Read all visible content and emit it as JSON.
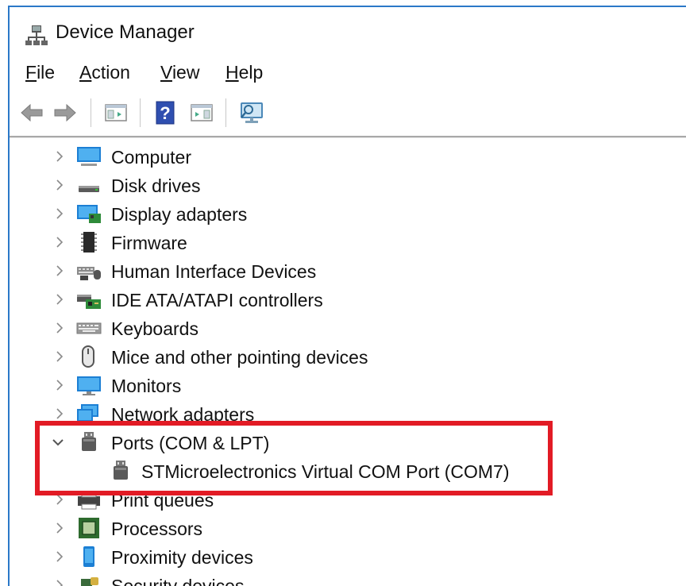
{
  "window": {
    "title": "Device Manager",
    "accent_color": "#2b78c8"
  },
  "menubar": {
    "items": [
      {
        "label": "File",
        "mnemonic": "F",
        "rest": "ile"
      },
      {
        "label": "Action",
        "mnemonic": "A",
        "rest": "ction"
      },
      {
        "label": "View",
        "mnemonic": "V",
        "rest": "iew"
      },
      {
        "label": "Help",
        "mnemonic": "H",
        "rest": "elp"
      }
    ]
  },
  "toolbar": {
    "buttons": [
      "back-icon",
      "forward-icon",
      "show-hide-console-tree-icon",
      "help-icon",
      "properties-icon",
      "scan-hardware-icon"
    ]
  },
  "tree": {
    "items": [
      {
        "label": "Computer",
        "expanded": false,
        "icon": "computer-icon"
      },
      {
        "label": "Disk drives",
        "expanded": false,
        "icon": "disk-drive-icon"
      },
      {
        "label": "Display adapters",
        "expanded": false,
        "icon": "display-adapter-icon"
      },
      {
        "label": "Firmware",
        "expanded": false,
        "icon": "firmware-chip-icon"
      },
      {
        "label": "Human Interface Devices",
        "expanded": false,
        "icon": "hid-icon"
      },
      {
        "label": "IDE ATA/ATAPI controllers",
        "expanded": false,
        "icon": "ide-controller-icon"
      },
      {
        "label": "Keyboards",
        "expanded": false,
        "icon": "keyboard-icon"
      },
      {
        "label": "Mice and other pointing devices",
        "expanded": false,
        "icon": "mouse-icon"
      },
      {
        "label": "Monitors",
        "expanded": false,
        "icon": "monitor-icon"
      },
      {
        "label": "Network adapters",
        "expanded": false,
        "icon": "network-adapter-icon"
      },
      {
        "label": "Ports (COM & LPT)",
        "expanded": true,
        "icon": "port-icon",
        "children": [
          {
            "label": "STMicroelectronics Virtual COM Port (COM7)",
            "icon": "port-icon"
          }
        ]
      },
      {
        "label": "Print queues",
        "expanded": false,
        "icon": "printer-icon"
      },
      {
        "label": "Processors",
        "expanded": false,
        "icon": "processor-icon"
      },
      {
        "label": "Proximity devices",
        "expanded": false,
        "icon": "proximity-device-icon"
      },
      {
        "label": "Security devices",
        "expanded": false,
        "icon": "security-device-icon"
      }
    ]
  },
  "highlight": {
    "color": "#e21b25",
    "target": "Ports (COM & LPT)"
  }
}
